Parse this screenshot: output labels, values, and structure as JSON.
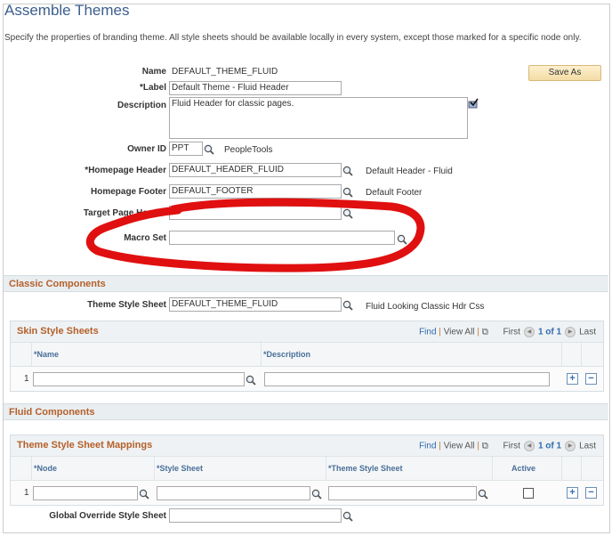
{
  "title": "Assemble Themes",
  "instructions": "Specify the properties of branding theme. All style sheets should be available locally in every system, except those marked for a specific node only.",
  "save_as": "Save As",
  "fields": {
    "name_label": "Name",
    "name_value": "DEFAULT_THEME_FLUID",
    "label_label": "*Label",
    "label_value": "Default Theme - Fluid Header",
    "description_label": "Description",
    "description_value": "Fluid Header for classic pages.",
    "owner_label": "Owner ID",
    "owner_value": "PPT",
    "owner_desc": "PeopleTools",
    "header_label": "*Homepage Header",
    "header_value": "DEFAULT_HEADER_FLUID",
    "header_desc": "Default Header - Fluid",
    "footer_label": "Homepage Footer",
    "footer_value": "DEFAULT_FOOTER",
    "footer_desc": "Default Footer",
    "target_label": "Target Page Header",
    "target_value": "",
    "macro_label": "Macro Set",
    "macro_value": ""
  },
  "annotation_color": "#e01010",
  "classic": {
    "header": "Classic Components",
    "theme_label": "Theme Style Sheet",
    "theme_value": "DEFAULT_THEME_FLUID",
    "theme_desc": "Fluid Looking Classic Hdr Css",
    "grid": {
      "title": "Skin Style Sheets",
      "find": "Find",
      "view_all": "View All",
      "first": "First",
      "pager": "1 of 1",
      "last": "Last",
      "columns": [
        "*Name",
        "*Description"
      ],
      "rows": [
        {
          "num": "1",
          "name": "",
          "description": ""
        }
      ]
    }
  },
  "fluid": {
    "header": "Fluid Components",
    "grid": {
      "title": "Theme Style Sheet Mappings",
      "find": "Find",
      "view_all": "View All",
      "first": "First",
      "pager": "1 of 1",
      "last": "Last",
      "columns": [
        "*Node",
        "*Style Sheet",
        "*Theme Style Sheet",
        "Active"
      ],
      "rows": [
        {
          "num": "1",
          "node": "",
          "style_sheet": "",
          "theme_style_sheet": "",
          "active": false
        }
      ]
    },
    "global_label": "Global Override Style Sheet",
    "global_value": ""
  }
}
